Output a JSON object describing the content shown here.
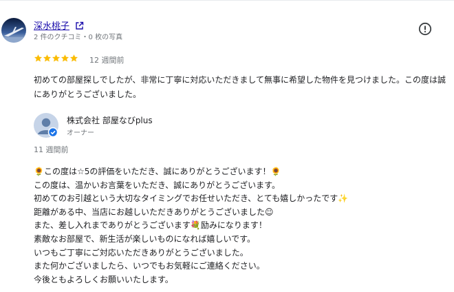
{
  "review": {
    "author_name": "深水桃子",
    "author_meta": "2 件のクチコミ・0 枚の写真",
    "rating": 5,
    "star_color": "#fbbc04",
    "time": "12 週間前",
    "text": "初めての部屋探しでしたが、非常に丁寧に対応いただきまして無事に希望した物件を見つけました。この度は誠にありがとうございました。"
  },
  "icons": {
    "external_link": "external-link-icon",
    "more": "exclamation-circle-icon",
    "verified": "verified-badge-icon"
  },
  "owner_reply": {
    "name": "株式会社 部屋なびplus",
    "role": "オーナー",
    "time": "11 週間前",
    "lines": [
      "🌻この度は☆5の評価をいただき、誠にありがとうございます！🌻",
      "この度は、温かいお言葉をいただき、誠にありがとうございます。",
      "初めてのお引越という大切なタイミングでお任せいただき、とても嬉しかったです✨",
      "距離がある中、当店にお越しいただきありがとうございました☺",
      "また、差し入れまでありがとうございます💐励みになります！",
      "素敵なお部屋で、新生活が楽しいものになれば嬉しいです。",
      "いつもご丁寧にご対応いただきありがとうございました。",
      "また何かございましたら、いつでもお気軽にご連絡ください。",
      "今後ともよろしくお願いいたします。"
    ]
  }
}
